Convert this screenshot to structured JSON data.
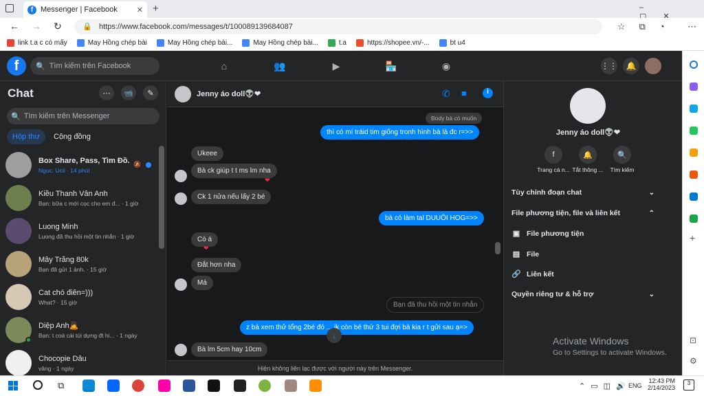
{
  "browser": {
    "tab_title": "Messenger | Facebook",
    "url": "https://www.facebook.com/messages/t/100089139684087",
    "bookmarks": [
      "link t.a c có mấy",
      "May Hồng chép bài",
      "May Hồng chép bài...",
      "May Hồng chép bài...",
      "t.a",
      "https://shopee.vn/-...",
      "bt u4"
    ]
  },
  "fb": {
    "logo": "f",
    "search_placeholder": "Tìm kiếm trên Facebook"
  },
  "sidebar": {
    "title": "Chat",
    "search_placeholder": "Tìm kiếm trên Messenger",
    "tabs": [
      "Hộp thư",
      "Cộng đồng"
    ],
    "conversations": [
      {
        "name": "Box Share, Pass, Tìm Đồ.",
        "preview": "Ngọc: Ucii · 14 phút"
      },
      {
        "name": "Kiều Thanh Vân Anh",
        "preview": "Bạn: bữa c mới cọc cho em đ... · 1 giờ"
      },
      {
        "name": "Luong Minh",
        "preview": "Luong đã thu hồi một tin nhắn · 1 giờ"
      },
      {
        "name": "Mây Trắng 80k",
        "preview": "Bạn đã gửi 1 ảnh. · 15 giờ"
      },
      {
        "name": "Cat chó điên=)))",
        "preview": "What? · 15 giờ"
      },
      {
        "name": "Diệp Anh🙇",
        "preview": "Bạn: t coá cái túi dựng đt hi... · 1 ngày"
      },
      {
        "name": "Chocopie Dâu",
        "preview": "vâng · 1 ngày"
      }
    ]
  },
  "chat": {
    "contact": "Jenny áo doll👽❤",
    "messages": [
      {
        "dir": "in",
        "text": "Body bà có muốn"
      },
      {
        "dir": "out",
        "text": "thì có mí tráid tim giống tronh hình bà là đc r=>>"
      },
      {
        "dir": "in",
        "text": "Ukeee"
      },
      {
        "dir": "in",
        "text": "Bà ck giúp t t ms lm nha"
      },
      {
        "dir": "in",
        "text": "Ck 1 nửa nếu lấy 2 bé"
      },
      {
        "dir": "out",
        "text": "bà có làm tal DUUÔI HOG=>>"
      },
      {
        "dir": "in",
        "text": "Có á"
      },
      {
        "dir": "in",
        "text": "Đắt hơn nha"
      },
      {
        "dir": "in",
        "text": "Má"
      },
      {
        "dir": "recalled",
        "text": "Bạn đã thu hồi một tin nhắn"
      },
      {
        "dir": "out",
        "text": "z bà xem thử tổng 2bé đó ... ik còn bé thứ 3 tui đợi bà kia r t gửi sau ạ=>"
      },
      {
        "dir": "in",
        "text": "Bà lm 5cm hay 10cm"
      }
    ],
    "heart": "❤",
    "footer": "Hiện không liên lạc được với người này trên Messenger."
  },
  "info": {
    "name": "Jenny áo doll👽❤",
    "actions": [
      "Trang cá n...",
      "Tắt thông ...",
      "Tìm kiếm"
    ],
    "rows": [
      "Tùy chỉnh đoạn chat",
      "File phương tiện, file và liên kết",
      "File phương tiện",
      "File",
      "Liên kết",
      "Quyền riêng tư & hỗ trợ"
    ]
  },
  "os": {
    "activate_title": "Activate Windows",
    "activate_sub": "Go to Settings to activate Windows.",
    "lang": "ENG",
    "time": "12:43 PM",
    "date": "2/14/2023",
    "notif": "3"
  }
}
